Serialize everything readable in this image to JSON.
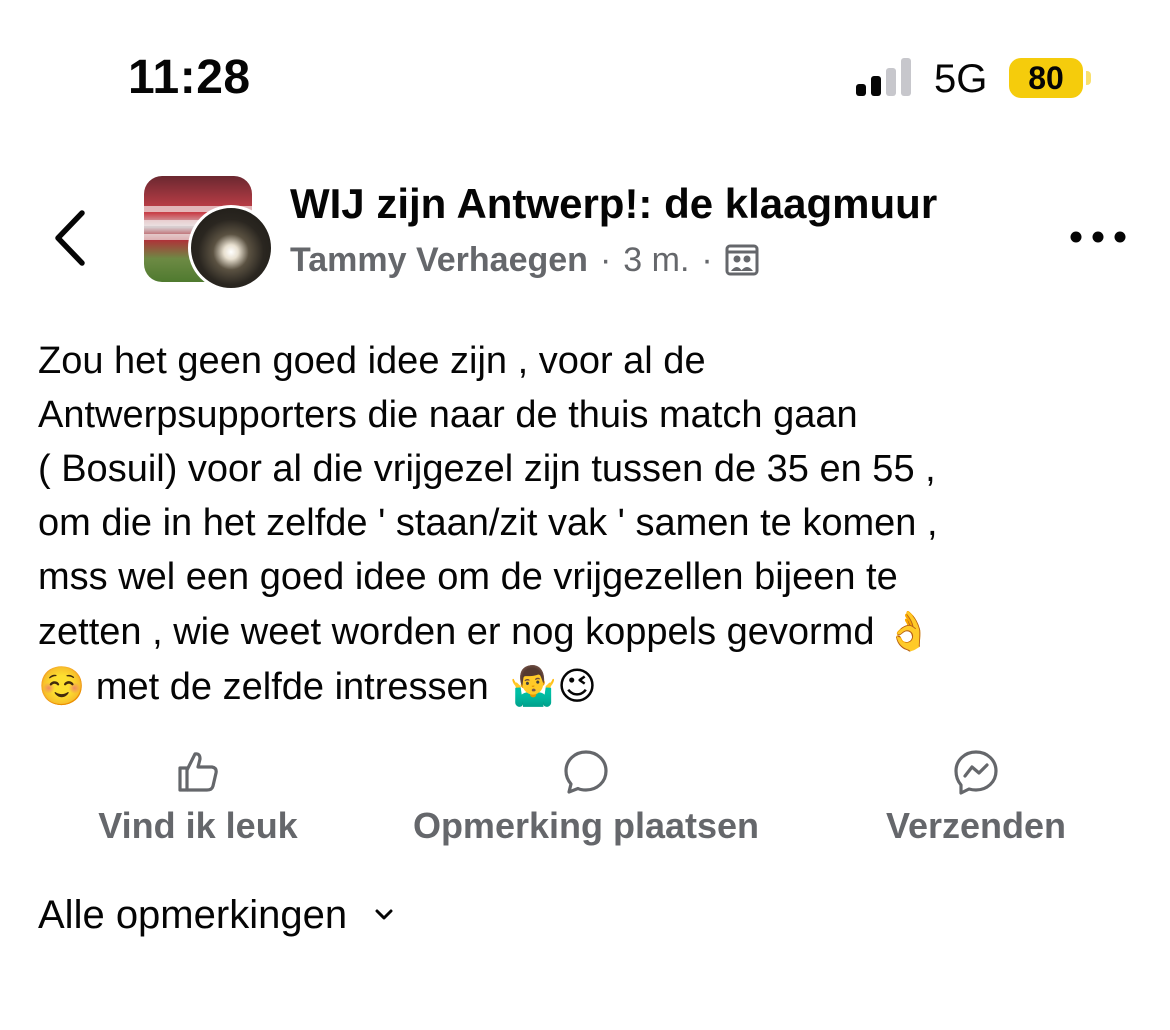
{
  "status_bar": {
    "time": "11:28",
    "network": "5G",
    "battery": "80",
    "battery_color": "#f5cc0c",
    "signal_bars": 2
  },
  "header": {
    "back_icon": "chevron-left-icon",
    "group_name": "WIJ zijn Antwerp!: de klaagmuur",
    "author": "Tammy Verhaegen",
    "time_ago": "3 m.",
    "separator": "·",
    "audience_icon": "group-icon",
    "more_icon": "more-horizontal-icon"
  },
  "post": {
    "text": "Zou het geen goed idee zijn , voor al de\nAntwerpsupporters die naar de thuis match gaan\n( Bosuil) voor al die vrijgezel zijn tussen de 35 en 55 ,\nom die in het zelfde ' staan/zit vak ' samen te komen ,\nmss wel een goed idee om de vrijgezellen bijeen te\nzetten , wie weet worden er nog koppels gevormd ",
    "emoji_ok": "👌",
    "emoji_smile": "☺️",
    "text_end": " met de zelfde intressen  ",
    "emoji_shrug": "🤷‍♂️",
    "emoji_wink": "😉"
  },
  "actions": {
    "like_label": "Vind ik leuk",
    "comment_label": "Opmerking plaatsen",
    "send_label": "Verzenden",
    "icon_color": "#65676b"
  },
  "comments": {
    "filter_label": "Alle opmerkingen"
  }
}
